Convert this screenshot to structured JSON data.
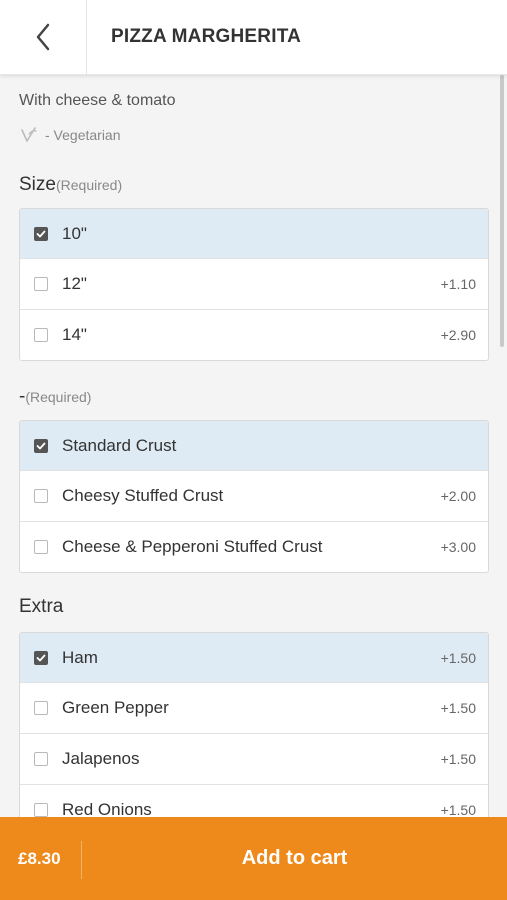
{
  "header": {
    "title": "PIZZA MARGHERITA",
    "back_icon": "chevron-left-icon"
  },
  "item": {
    "description": "With cheese & tomato",
    "diet_label": "- Vegetarian",
    "diet_icon": "vegetarian-v-icon"
  },
  "sections": [
    {
      "title": "Size",
      "required": "(Required)",
      "options": [
        {
          "label": "10\"",
          "price": "",
          "checked": true
        },
        {
          "label": "12\"",
          "price": "+1.10",
          "checked": false
        },
        {
          "label": "14\"",
          "price": "+2.90",
          "checked": false
        }
      ]
    },
    {
      "title": "-",
      "required": "(Required)",
      "options": [
        {
          "label": "Standard Crust",
          "price": "",
          "checked": true
        },
        {
          "label": "Cheesy Stuffed Crust",
          "price": "+2.00",
          "checked": false
        },
        {
          "label": "Cheese & Pepperoni Stuffed Crust",
          "price": "+3.00",
          "checked": false
        }
      ]
    },
    {
      "title": "Extra",
      "required": "",
      "options": [
        {
          "label": "Ham",
          "price": "+1.50",
          "checked": true
        },
        {
          "label": "Green Pepper",
          "price": "+1.50",
          "checked": false
        },
        {
          "label": "Jalapenos",
          "price": "+1.50",
          "checked": false
        },
        {
          "label": "Red Onions",
          "price": "+1.50",
          "checked": false
        }
      ]
    }
  ],
  "footer": {
    "total": "£8.30",
    "cart_label": "Add to cart"
  },
  "colors": {
    "accent": "#ee8a1c",
    "selected_row": "#deebf4"
  }
}
